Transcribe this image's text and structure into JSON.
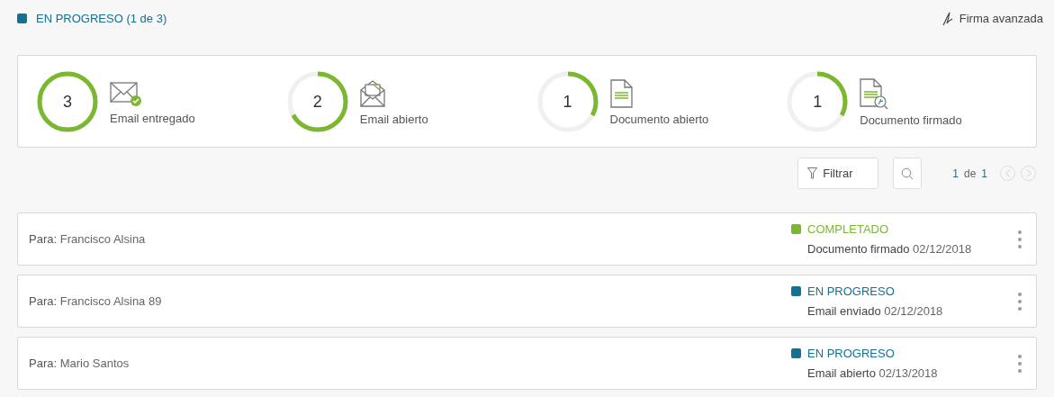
{
  "header": {
    "status": "EN PROGRESO (1 de 3)",
    "color": "#16708f",
    "action": "Firma avanzada"
  },
  "stats": [
    {
      "count": "3",
      "label": "Email entregado",
      "level": 1,
      "kind": "delivered"
    },
    {
      "count": "2",
      "label": "Email abierto",
      "level": 0.67,
      "kind": "opened"
    },
    {
      "count": "1",
      "label": "Documento abierto",
      "level": 0.33,
      "kind": "document"
    },
    {
      "count": "1",
      "label": "Documento firmado",
      "level": 0.33,
      "kind": "signed"
    }
  ],
  "toolbar": {
    "filter": "Filtrar",
    "page": "1",
    "of": "de",
    "total": "1"
  },
  "rows": [
    {
      "label": "Para:",
      "name": "Francisco Alsina",
      "status": "COMPLETADO",
      "color": "#7cb82f",
      "event": "Documento firmado",
      "date": "02/12/2018"
    },
    {
      "label": "Para:",
      "name": "Francisco Alsina 89",
      "status": "EN PROGRESO",
      "color": "#16708f",
      "event": "Email enviado",
      "date": "02/12/2018"
    },
    {
      "label": "Para:",
      "name": "Mario Santos",
      "status": "EN PROGRESO",
      "color": "#16708f",
      "event": "Email abierto",
      "date": "02/13/2018"
    }
  ]
}
